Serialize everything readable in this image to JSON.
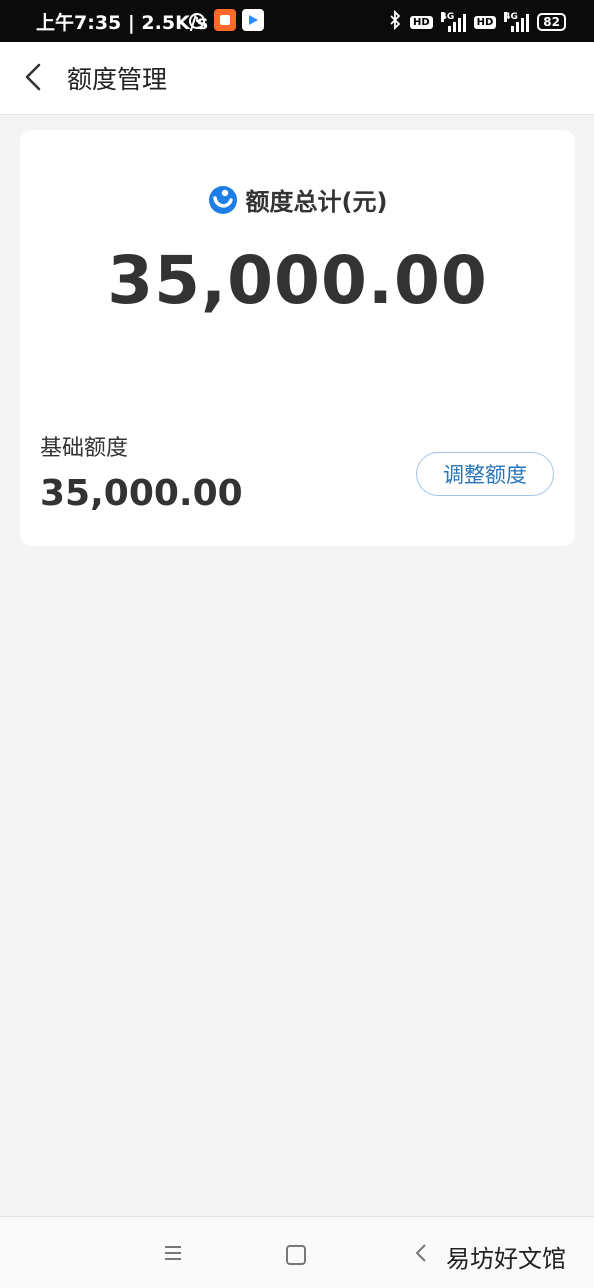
{
  "status_bar": {
    "time": "上午7:35 | 2.5K/s",
    "battery": "82",
    "network": "4G"
  },
  "header": {
    "title": "额度管理"
  },
  "card": {
    "total_label": "额度总计(元)",
    "total_amount": "35,000.00",
    "base_label": "基础额度",
    "base_amount": "35,000.00",
    "adjust_button": "调整额度"
  },
  "watermark": "易坊好文馆",
  "colors": {
    "accent": "#2a74b8",
    "logo_blue": "#1e7ee6",
    "background": "#f4f4f4"
  }
}
